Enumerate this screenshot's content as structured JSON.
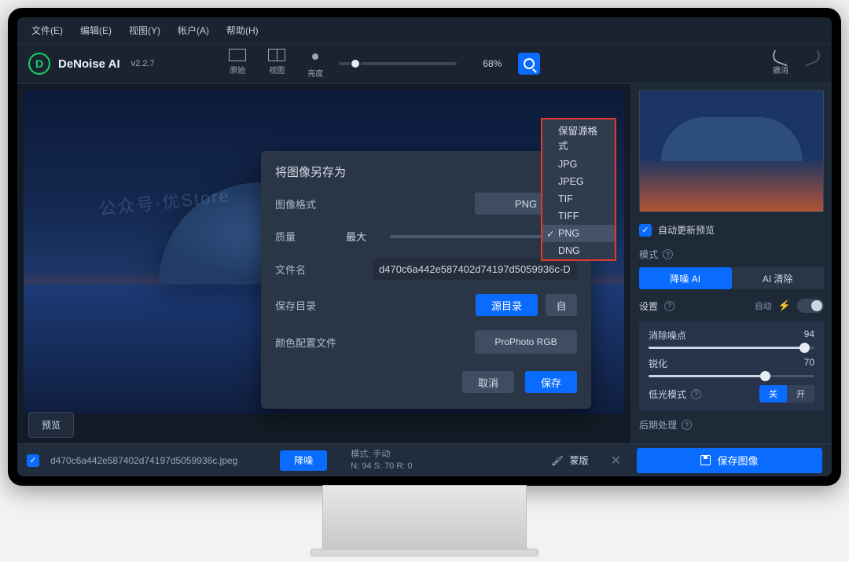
{
  "menu": {
    "file": "文件(E)",
    "edit": "编辑(E)",
    "view": "视图(Y)",
    "account": "帐户(A)",
    "help": "帮助(H)"
  },
  "brand": {
    "logo": "D",
    "name": "DeNoise AI",
    "version": "v2.2.7"
  },
  "viewmodes": {
    "original": "原始",
    "split": "视图",
    "brightness": "亮度"
  },
  "zoom": {
    "percent": "68%"
  },
  "history": {
    "undo": "撤消",
    "redo": ""
  },
  "watermark": "公众号·优Store",
  "preview_btn": "预览",
  "dialog": {
    "title": "将图像另存为",
    "format_label": "图像格式",
    "format_value": "PNG",
    "quality_label": "质量",
    "quality_value_label": "最大",
    "filename_label": "文件名",
    "filename_value": "d470c6a442e587402d74197d5059936c-D",
    "savedir_label": "保存目录",
    "source_dir_btn": "源目录",
    "profile_label": "颜色配置文件",
    "profile_value": "ProPhoto RGB",
    "cancel": "取消",
    "save": "保存"
  },
  "format_options": [
    "保留源格式",
    "JPG",
    "JPEG",
    "TIF",
    "TIFF",
    "PNG",
    "DNG"
  ],
  "format_selected": "PNG",
  "sidebar": {
    "auto_update": "自动更新预览",
    "mode_label": "模式",
    "tab_denoise": "降噪 AI",
    "tab_clear": "AI 清除",
    "settings_label": "设置",
    "auto_label": "自动",
    "remove_noise": {
      "label": "消除噪点",
      "value": "94",
      "pct": 94
    },
    "sharpen": {
      "label": "锐化",
      "value": "70",
      "pct": 70
    },
    "lowlight_label": "低光模式",
    "seg_off": "关",
    "seg_on": "开",
    "post_label": "后期处理"
  },
  "bottom": {
    "filename": "d470c6a442e587402d74197d5059936c.jpeg",
    "action": "降噪",
    "mode_line": "模式: 手动",
    "stats_line": "N: 94  S: 70  R: 0",
    "mask": "蒙版",
    "save": "保存图像"
  }
}
